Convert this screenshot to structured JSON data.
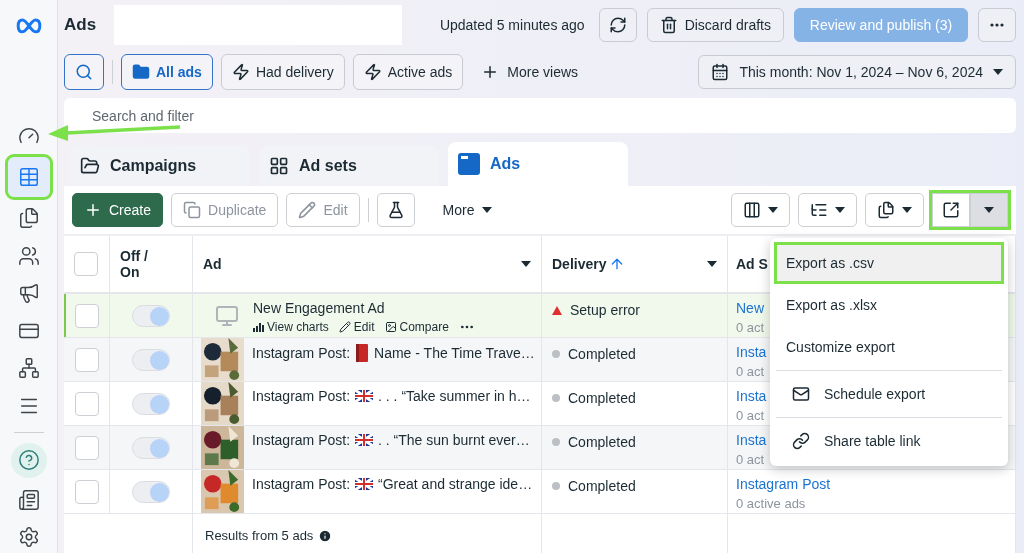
{
  "sidebar": {
    "items": [
      {
        "selected": false,
        "highlighted": false
      },
      {
        "selected": true,
        "highlighted": true
      },
      {
        "selected": false,
        "highlighted": false
      },
      {
        "selected": false,
        "highlighted": false
      },
      {
        "selected": false,
        "highlighted": false
      },
      {
        "selected": false,
        "highlighted": false
      },
      {
        "selected": false,
        "highlighted": false
      },
      {
        "selected": false,
        "highlighted": false
      },
      {
        "selected": false,
        "highlighted": false
      },
      {
        "selected": false,
        "highlighted": false
      },
      {
        "selected": false,
        "highlighted": false
      }
    ]
  },
  "annotation_arrow": true,
  "header": {
    "title": "Ads",
    "updated": "Updated 5 minutes ago",
    "buttons": [
      {
        "label": "Discard drafts",
        "disabled": false
      },
      {
        "label": "Review and publish (3)",
        "disabled": true
      }
    ]
  },
  "views": [
    {
      "label": "All ads",
      "selected": true
    },
    {
      "label": "Had delivery",
      "selected": false
    },
    {
      "label": "Active ads",
      "selected": false
    }
  ],
  "more_views": "More views",
  "date_range": "This month: Nov 1, 2024 – Nov 6, 2024",
  "search": {
    "placeholder": "Search and filter"
  },
  "tabs": [
    {
      "label": "Campaigns",
      "selected": false
    },
    {
      "label": "Ad sets",
      "selected": false
    },
    {
      "label": "Ads",
      "selected": true
    }
  ],
  "toolbar": {
    "buttons": [
      {
        "label": "Create",
        "kind": "primary",
        "disabled": false
      },
      {
        "label": "Duplicate",
        "kind": "duplicate",
        "disabled": true
      },
      {
        "label": "Edit",
        "kind": "edit",
        "disabled": true
      }
    ],
    "more": "More",
    "export_highlighted": true,
    "export_open": true
  },
  "table": {
    "header_checked": false,
    "columns": [
      "Off / On",
      "Ad",
      "Delivery",
      "Ad S"
    ],
    "rows": [
      {
        "checked": false,
        "draft": true,
        "on": true,
        "thumbnail": {
          "kind": "placeholder"
        },
        "name": [
          {
            "kind": "text",
            "text": "New Engagement Ad"
          }
        ],
        "actions": [
          "View charts",
          "Edit",
          "Compare"
        ],
        "delivery": {
          "kind": "error",
          "label": "Setup error"
        },
        "ad_set": "New",
        "ad_set_sub": "0 act"
      },
      {
        "checked": false,
        "draft": false,
        "on": true,
        "thumbnail": {
          "kind": "picture"
        },
        "name": [
          {
            "kind": "text",
            "text": "Instagram Post:"
          },
          {
            "kind": "book"
          },
          {
            "kind": "text",
            "text": "Name - The Time Trave…"
          }
        ],
        "delivery": {
          "kind": "completed",
          "label": "Completed"
        },
        "ad_set": "Insta",
        "ad_set_sub": "0 act"
      },
      {
        "checked": false,
        "draft": false,
        "on": true,
        "thumbnail": {
          "kind": "picture"
        },
        "name": [
          {
            "kind": "text",
            "text": "Instagram Post:"
          },
          {
            "kind": "flag"
          },
          {
            "kind": "text",
            "text": ". . . “Take summer in h…"
          }
        ],
        "delivery": {
          "kind": "completed",
          "label": "Completed"
        },
        "ad_set": "Insta",
        "ad_set_sub": "0 act"
      },
      {
        "checked": false,
        "draft": false,
        "on": true,
        "thumbnail": {
          "kind": "picture"
        },
        "name": [
          {
            "kind": "text",
            "text": "Instagram Post:"
          },
          {
            "kind": "flag"
          },
          {
            "kind": "text",
            "text": ". . “The sun burnt ever…"
          }
        ],
        "delivery": {
          "kind": "completed",
          "label": "Completed"
        },
        "ad_set": "Insta",
        "ad_set_sub": "0 act"
      },
      {
        "checked": false,
        "draft": false,
        "on": true,
        "thumbnail": {
          "kind": "picture"
        },
        "name": [
          {
            "kind": "text",
            "text": "Instagram Post:"
          },
          {
            "kind": "flag"
          },
          {
            "kind": "text",
            "text": "“Great and strange ide…"
          }
        ],
        "delivery": {
          "kind": "completed",
          "label": "Completed"
        },
        "ad_set": "Instagram Post",
        "ad_set_sub": "0 active ads"
      }
    ],
    "footer": "Results from 5 ads"
  },
  "export_menu": {
    "items": [
      {
        "label": "Export as .csv",
        "kind": "plain",
        "selected": true,
        "highlighted": true,
        "divider_before": false
      },
      {
        "label": "Export as .xlsx",
        "kind": "plain",
        "selected": false,
        "highlighted": false,
        "divider_before": false
      },
      {
        "label": "Customize export",
        "kind": "plain",
        "selected": false,
        "highlighted": false,
        "divider_before": false
      },
      {
        "label": "Schedule export",
        "kind": "schedule",
        "selected": false,
        "highlighted": false,
        "divider_before": true
      },
      {
        "label": "Share table link",
        "kind": "link",
        "selected": false,
        "highlighted": false,
        "divider_before": true
      }
    ]
  }
}
